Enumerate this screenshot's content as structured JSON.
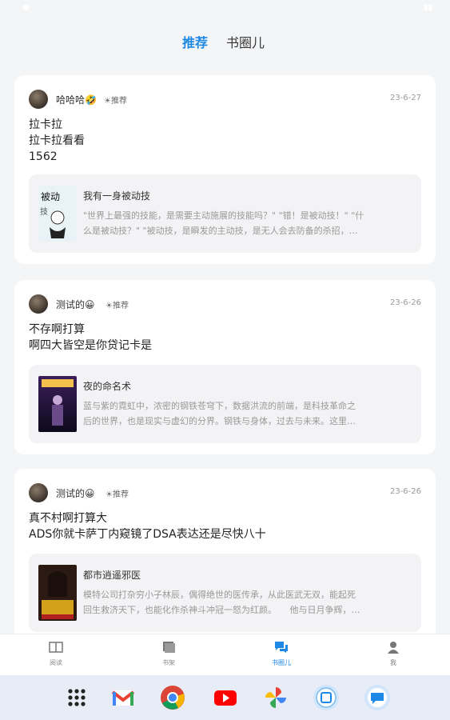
{
  "header": {
    "tabs": [
      {
        "label": "推荐",
        "active": true
      },
      {
        "label": "书圈儿",
        "active": false
      }
    ]
  },
  "posts": [
    {
      "username": "哈哈哈🤣",
      "badge": "☀推荐",
      "date": "23-6-27",
      "lines": [
        "拉卡拉",
        "拉卡拉看看",
        "1562"
      ],
      "book": {
        "title": "我有一身被动技",
        "desc": [
          "\"世界上最强的技能，是需要主动施展的技能吗？\" \"错！是被动技！\" \"什",
          "么是被动技？\" \"被动技，是瞬发的主动技，是无人会去防备的杀招，…"
        ]
      }
    },
    {
      "username": "测试的😀",
      "badge": "☀推荐",
      "date": "23-6-26",
      "lines": [
        "不存啊打算",
        "啊四大皆空是你贷记卡是"
      ],
      "book": {
        "title": "夜的命名术",
        "desc": [
          "蓝与紫的霓虹中，浓密的钢铁苍穹下，数据洪流的前端，是科技革命之",
          "后的世界，也是现实与虚幻的分界。钢铁与身体，过去与未来。这里…"
        ]
      }
    },
    {
      "username": "测试的😀",
      "badge": "☀推荐",
      "date": "23-6-26",
      "lines": [
        "真不村啊打算大",
        "ADS你就卡萨丁内窥镜了DSA表达还是尽快八十"
      ],
      "book": {
        "title": "都市逍遥邪医",
        "desc": [
          "模特公司打杂穷小子林辰，偶得绝世的医传承，从此医武无双，能起死",
          "回生救济天下，也能化作杀神斗冲冠一怒为红颜。　　他与日月争辉，…"
        ]
      }
    }
  ],
  "bottom_nav": [
    {
      "label": "阅读",
      "icon": "reading-icon",
      "active": false
    },
    {
      "label": "书架",
      "icon": "bookshelf-icon",
      "active": false
    },
    {
      "label": "书圈儿",
      "icon": "chat-bubbles-icon",
      "active": true
    },
    {
      "label": "我",
      "icon": "person-icon",
      "active": false
    }
  ],
  "dock": [
    "apps-grid-icon",
    "gmail-icon",
    "chrome-icon",
    "youtube-icon",
    "photos-icon",
    "reader-app-icon",
    "messages-icon"
  ],
  "colors": {
    "accent": "#1e88e5",
    "background": "#f4f5f7",
    "card": "#ffffff",
    "book_bg": "#f3f3f5"
  }
}
